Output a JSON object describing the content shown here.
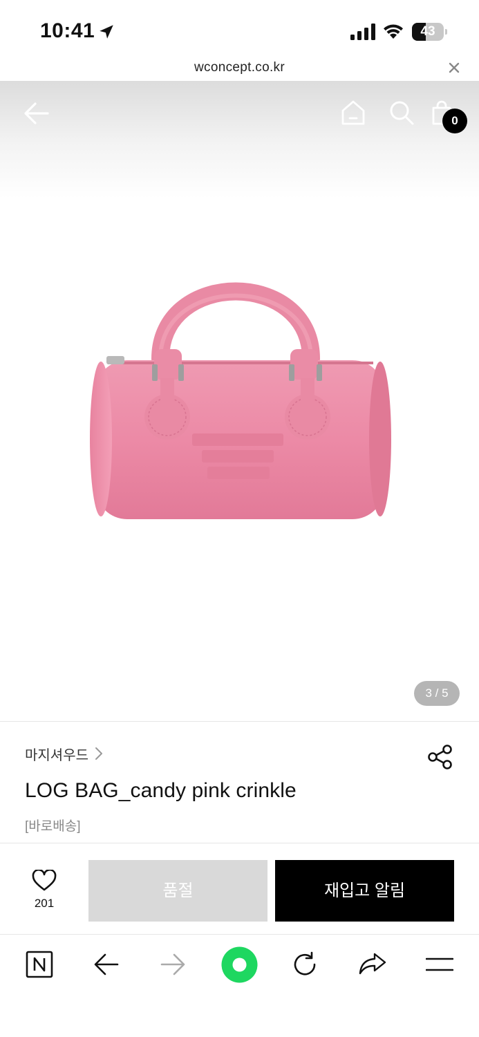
{
  "status_bar": {
    "time": "10:41",
    "battery": "43",
    "battery_level": 0.43,
    "icons": [
      "location-arrow-icon",
      "cellular-signal-icon",
      "wifi-icon",
      "battery-icon"
    ]
  },
  "browser": {
    "url": "wconcept.co.kr",
    "close_icon": "close-icon"
  },
  "header": {
    "icons": [
      "back-arrow-icon",
      "home-icon",
      "search-icon",
      "shopping-bag-icon"
    ],
    "cart_count": "0"
  },
  "gallery": {
    "pager": "3 / 5",
    "image_icon": "pink-handbag-image",
    "bag_color": "#ec8aa6"
  },
  "product": {
    "brand": "마지셔우드",
    "title": "LOG BAG_candy pink crinkle",
    "delivery_tag": "[바로배송]",
    "share_icon": "share-icon"
  },
  "purchase": {
    "like_count": "201",
    "soldout_label": "품절",
    "restock_label": "재입고 알림",
    "colors": {
      "soldout_bg": "#d9d9d9",
      "restock_bg": "#000000"
    }
  },
  "toolbar": {
    "icons": [
      "naver-icon",
      "back-icon",
      "forward-icon",
      "green-dot-icon",
      "reload-icon",
      "share-icon",
      "menu-icon"
    ],
    "accent": "#1ed760"
  }
}
